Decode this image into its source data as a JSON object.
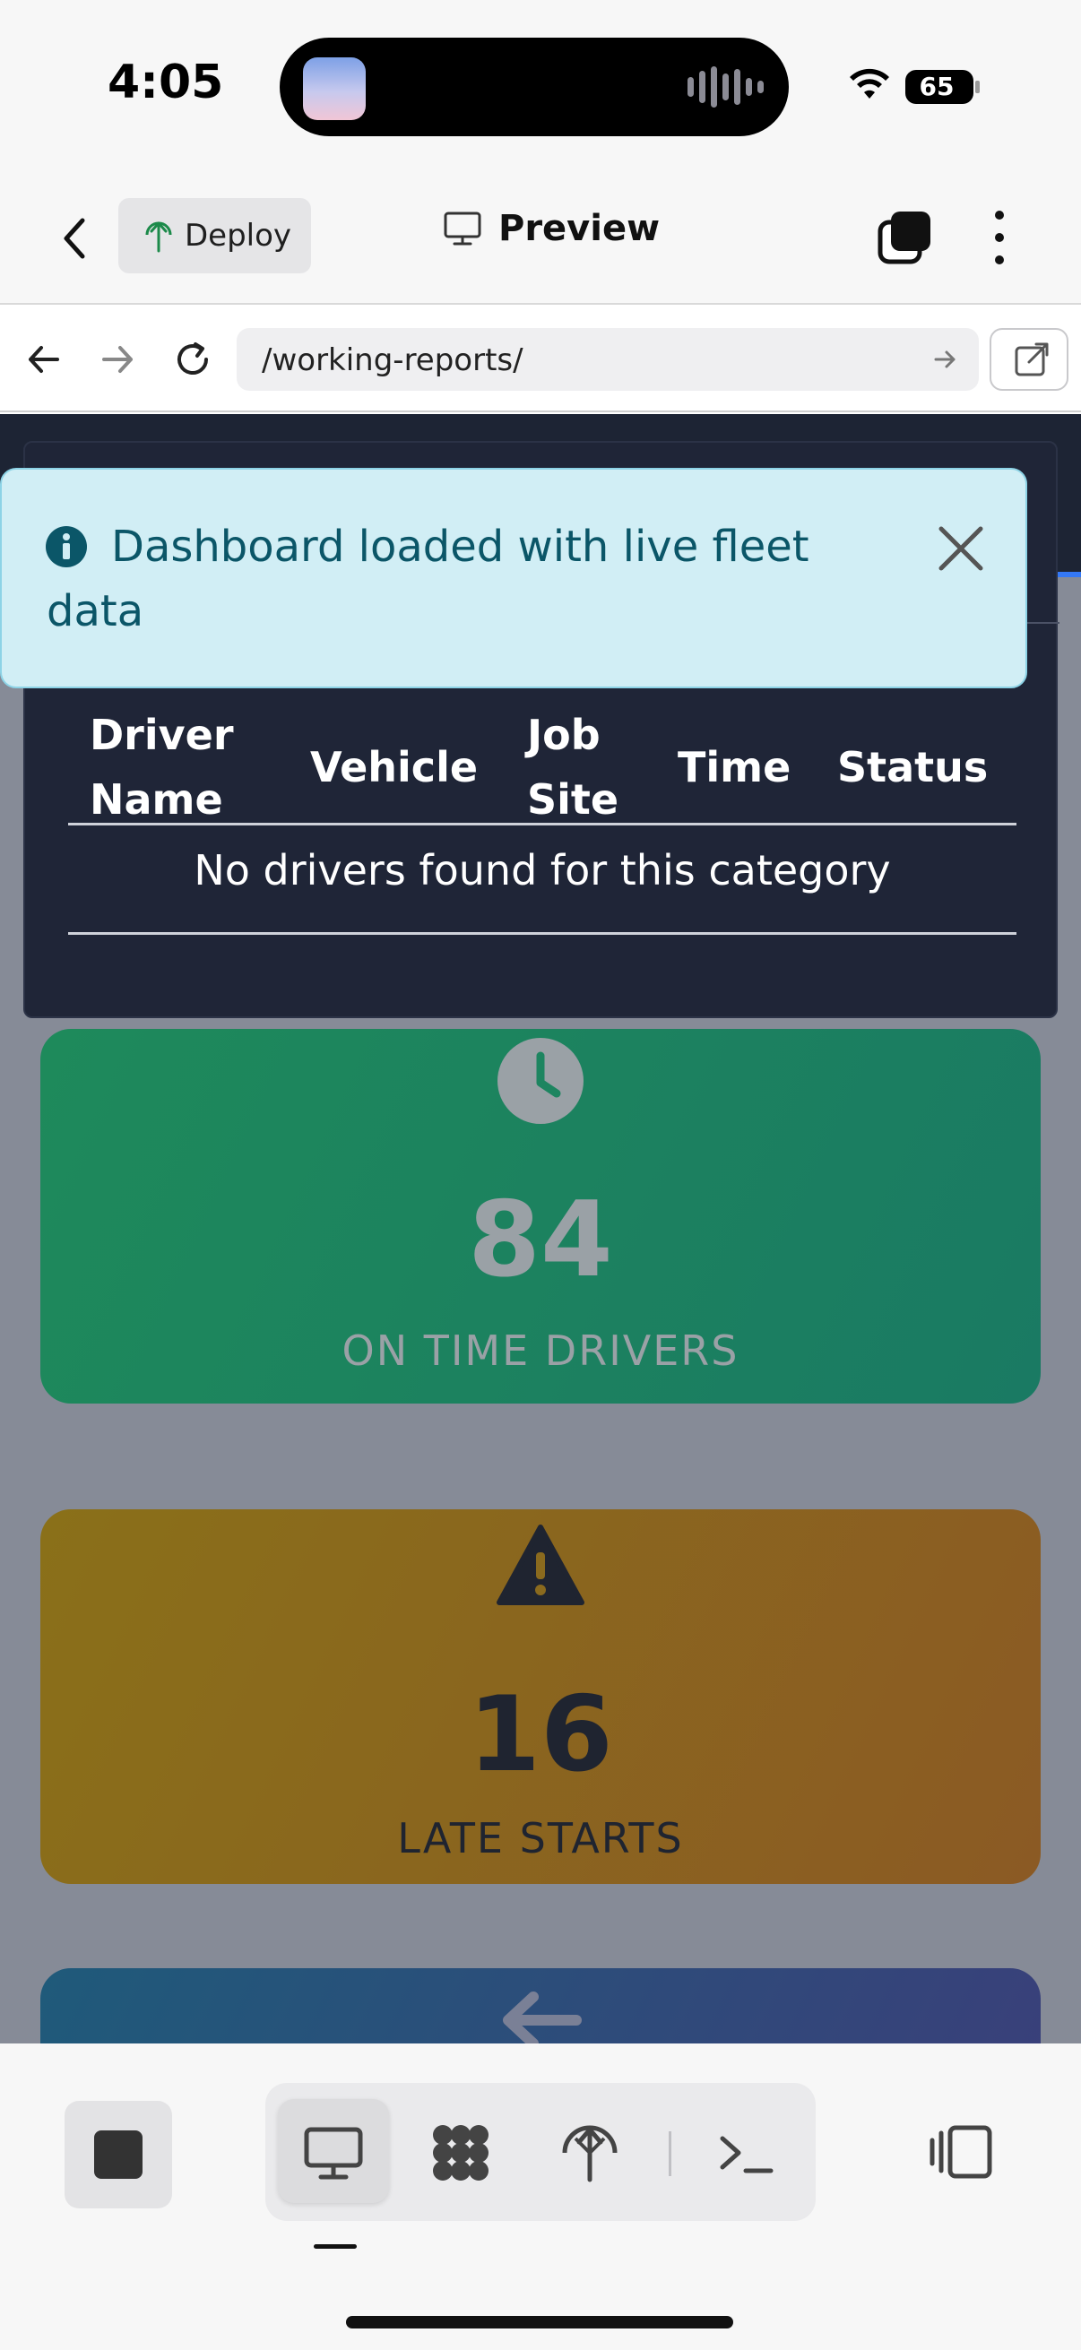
{
  "status_bar": {
    "time": "4:05",
    "battery": "65"
  },
  "toolbar": {
    "deploy_label": "Deploy",
    "preview_label": "Preview"
  },
  "url_bar": {
    "url": "/working-reports/"
  },
  "toast": {
    "message": "Dashboard loaded with live fleet data"
  },
  "drivers_table": {
    "headers": [
      "Driver Name",
      "Vehicle",
      "Job Site",
      "Time",
      "Status"
    ],
    "empty_message": "No drivers found for this category"
  },
  "stats": [
    {
      "value": "84",
      "label": "ON TIME DRIVERS",
      "icon": "clock-icon",
      "color": "#1e8a5b"
    },
    {
      "value": "16",
      "label": "LATE STARTS",
      "icon": "warning-icon",
      "color": "#8a7019"
    },
    {
      "icon": "arrow-left-icon",
      "color": "#1f5a7a"
    }
  ],
  "bottom_bar": {
    "modes": [
      "preview-icon",
      "integrations-icon",
      "deploy-icon",
      "terminal-icon"
    ],
    "active_mode": "preview-icon"
  }
}
